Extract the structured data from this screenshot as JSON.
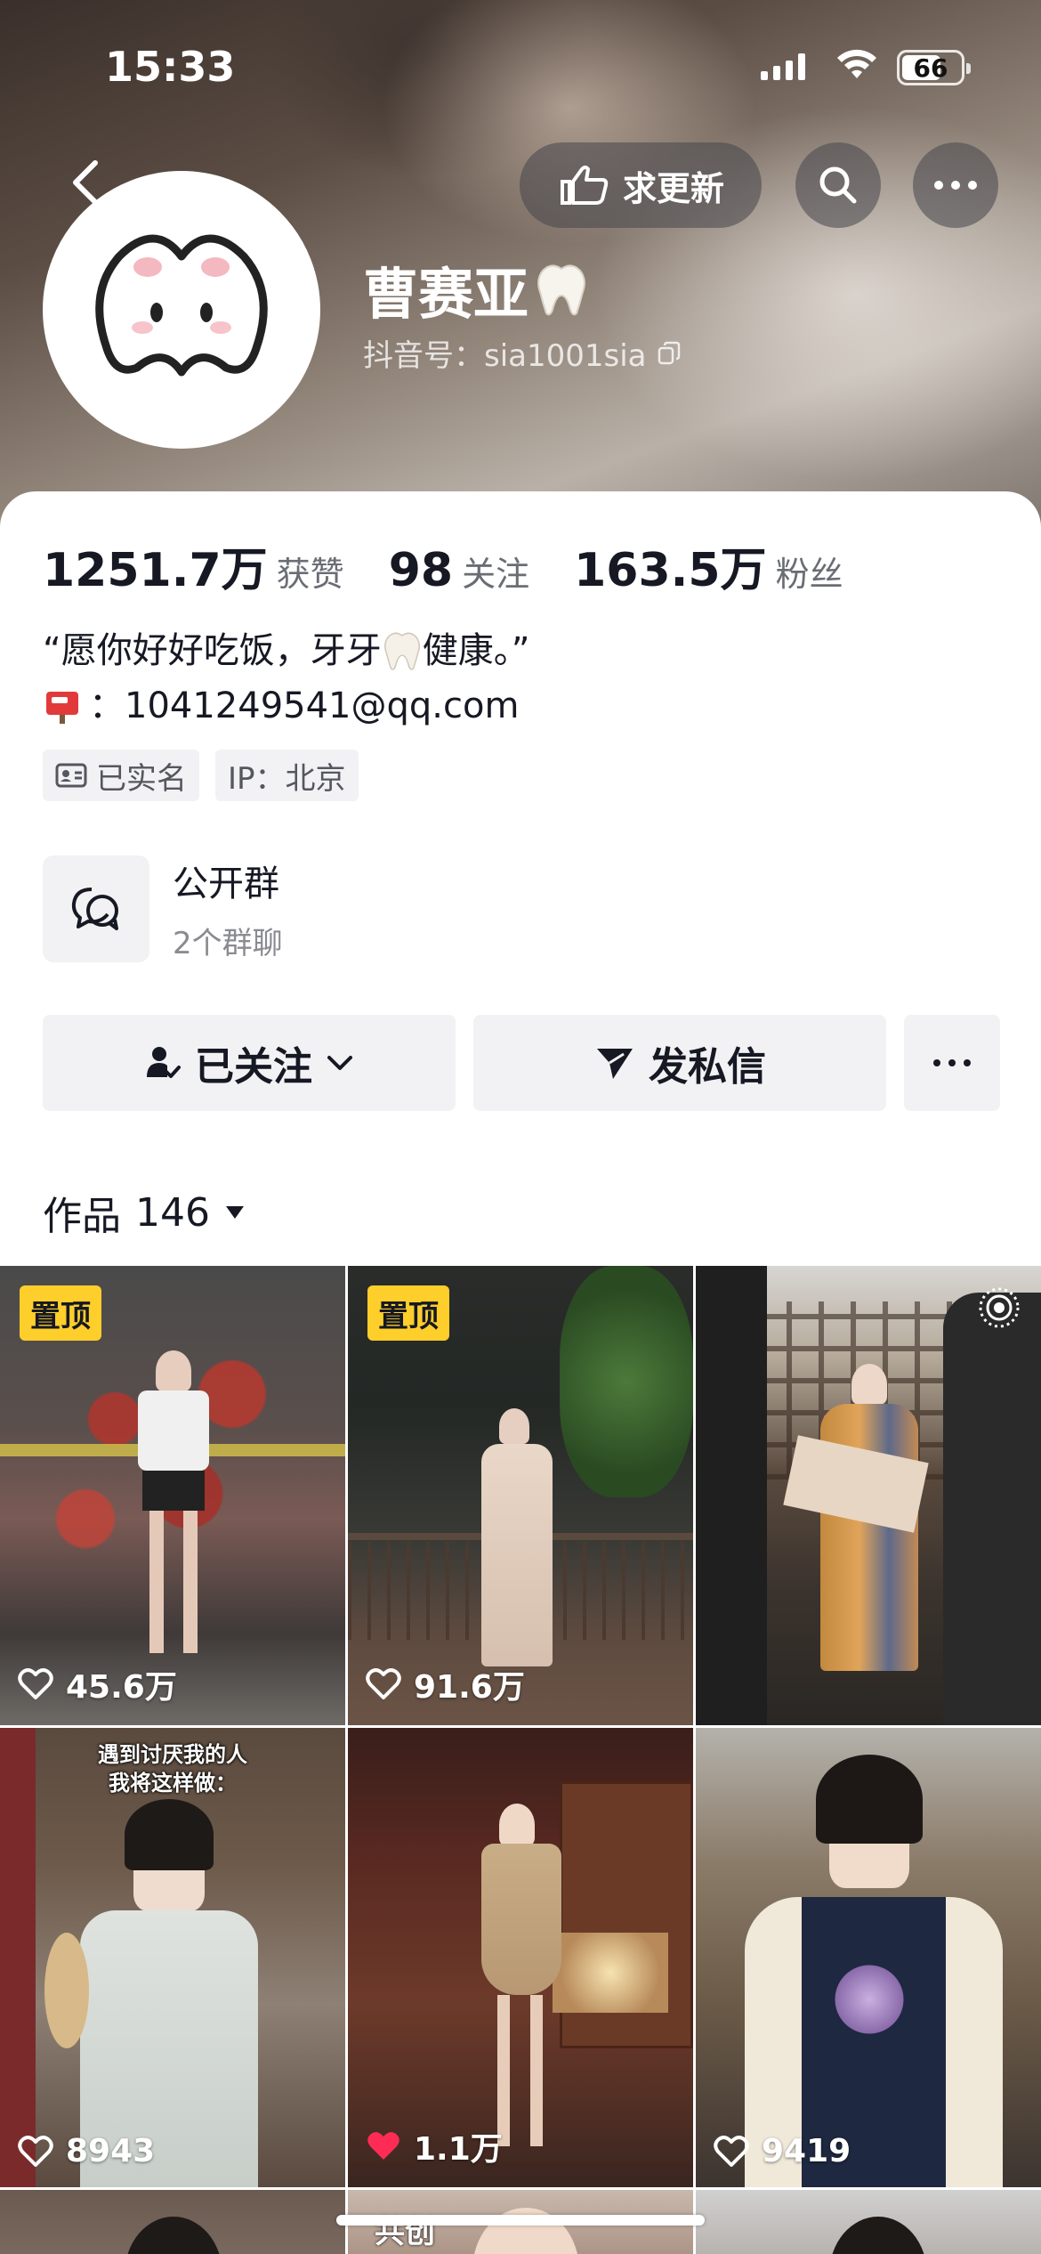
{
  "status": {
    "time": "15:33",
    "battery": "66"
  },
  "header": {
    "update_label": "求更新",
    "name": "曹赛亚",
    "douyin_id": "抖音号：sia1001sia"
  },
  "stats": [
    {
      "value": "1251.7万",
      "label": "获赞"
    },
    {
      "value": "98",
      "label": "关注"
    },
    {
      "value": "163.5万",
      "label": "粉丝"
    }
  ],
  "bio": {
    "line1_a": "“愿你好好吃饭，牙牙",
    "line1_b": "健康。”",
    "email": "：1041249541@qq.com"
  },
  "tags": {
    "verified": "已实名",
    "ip": "IP：北京"
  },
  "group": {
    "title": "公开群",
    "subtitle": "2个群聊"
  },
  "actions": {
    "follow": "已关注",
    "message": "发私信"
  },
  "works": {
    "label": "作品",
    "count": "146"
  },
  "grid": [
    {
      "pinned": "置顶",
      "likes": "45.6万",
      "liked": false
    },
    {
      "pinned": "置顶",
      "likes": "91.6万",
      "liked": false
    },
    {
      "pinned": "",
      "likes": "",
      "liked": false
    },
    {
      "pinned": "",
      "likes": "8943",
      "liked": false,
      "overlay": "遇到讨厌我的人\n我将这样做："
    },
    {
      "pinned": "",
      "likes": "1.1万",
      "liked": true
    },
    {
      "pinned": "",
      "likes": "9419",
      "liked": false
    },
    {
      "pinned": "",
      "likes": "",
      "liked": false
    },
    {
      "pinned": "",
      "likes": "",
      "liked": false,
      "tag": "共创"
    },
    {
      "pinned": "",
      "likes": "",
      "liked": false
    }
  ],
  "colors": {
    "accent_pin": "#fece2b",
    "like_red": "#fe2c55",
    "panel_bg": "#f2f2f4"
  }
}
